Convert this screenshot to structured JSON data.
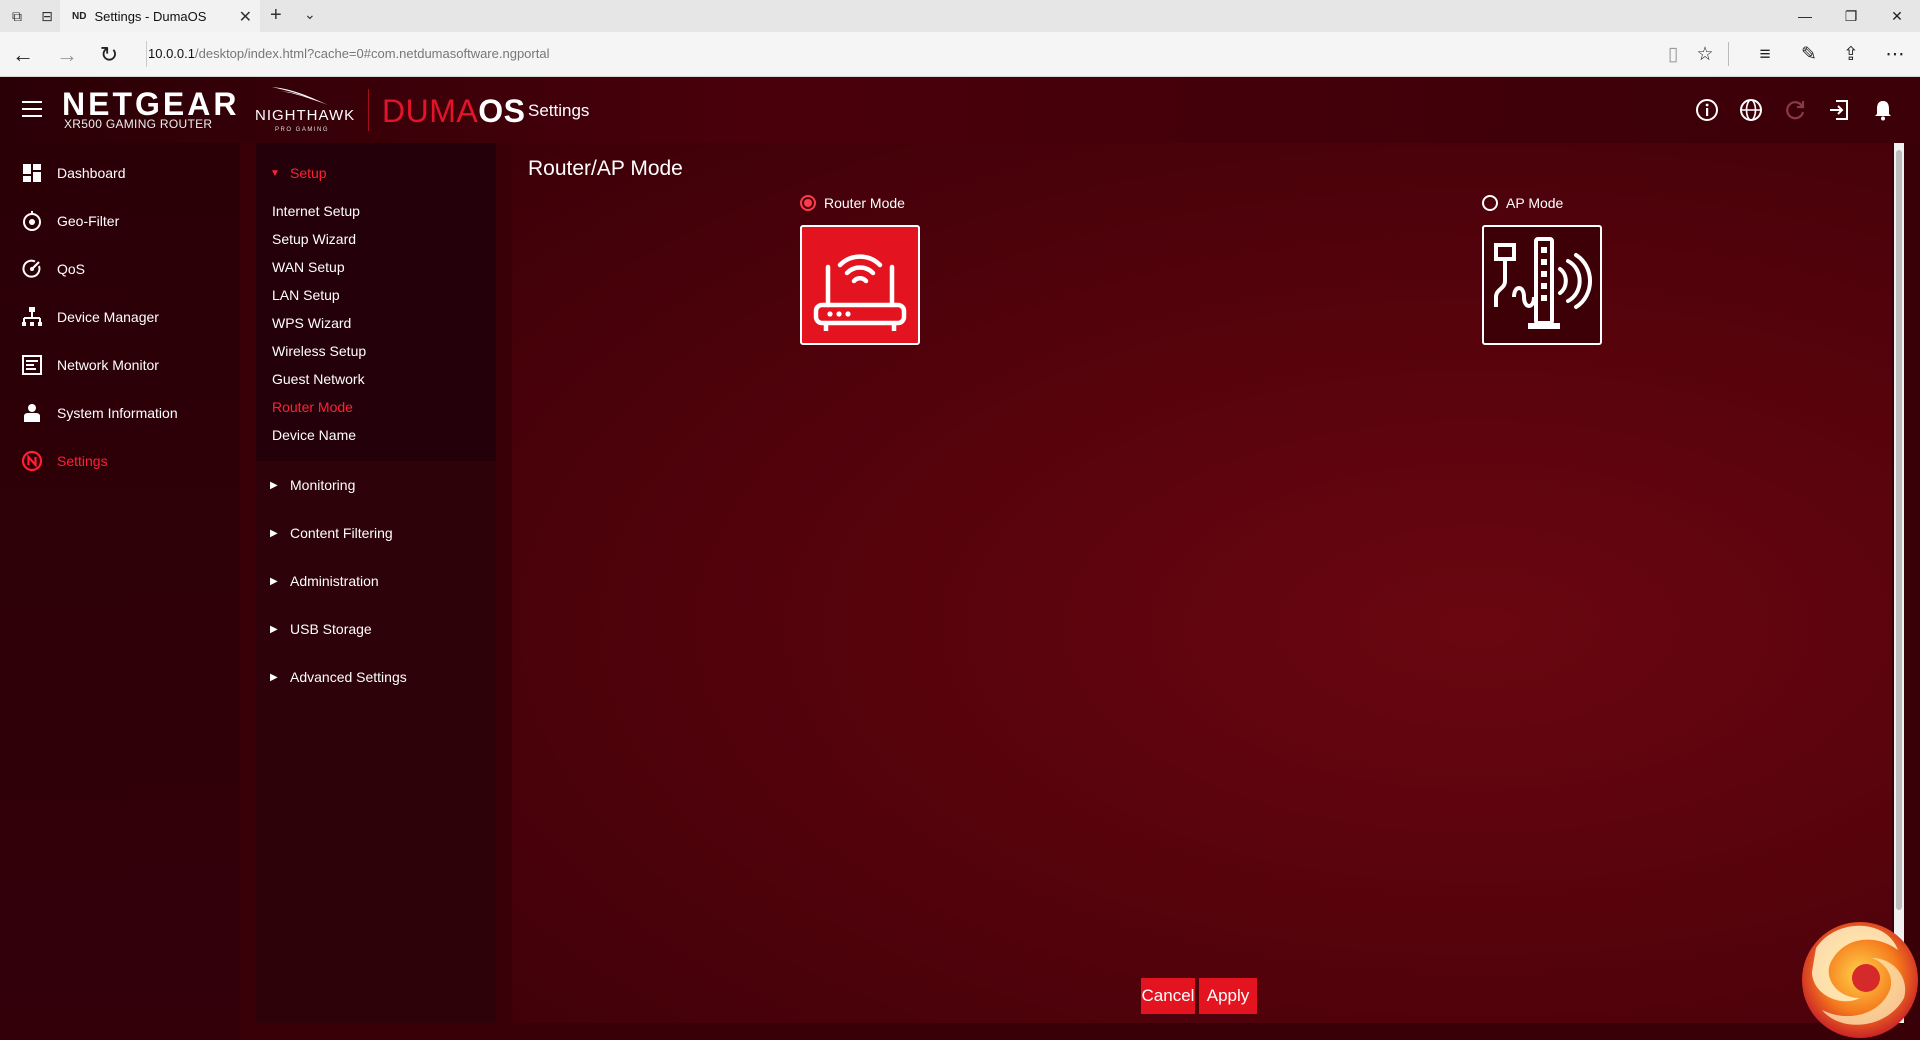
{
  "browser": {
    "tab_title": "Settings - DumaOS",
    "tab_favicon": "ND",
    "url_host": "10.0.0.1",
    "url_path": "/desktop/index.html?cache=0#com.netdumasoftware.ngportal"
  },
  "header": {
    "brand": "NETGEAR",
    "brand_sub": "XR500 GAMING ROUTER",
    "nighthawk": "NIGHTHAWK",
    "nighthawk_sub": "PRO GAMING",
    "duma_light": "DUMA",
    "duma_bold": "OS",
    "title": "Settings"
  },
  "leftnav": {
    "items": [
      {
        "label": "Dashboard",
        "icon": "dashboard-icon"
      },
      {
        "label": "Geo-Filter",
        "icon": "geo-filter-icon"
      },
      {
        "label": "QoS",
        "icon": "qos-icon"
      },
      {
        "label": "Device Manager",
        "icon": "device-manager-icon"
      },
      {
        "label": "Network Monitor",
        "icon": "network-monitor-icon"
      },
      {
        "label": "System Information",
        "icon": "system-information-icon"
      },
      {
        "label": "Settings",
        "icon": "settings-icon",
        "active": true
      }
    ]
  },
  "subnav": {
    "setup": {
      "label": "Setup",
      "links": [
        "Internet Setup",
        "Setup Wizard",
        "WAN Setup",
        "LAN Setup",
        "WPS Wizard",
        "Wireless Setup",
        "Guest Network",
        "Router Mode",
        "Device Name"
      ],
      "active": "Router Mode"
    },
    "sections": [
      "Monitoring",
      "Content Filtering",
      "Administration",
      "USB Storage",
      "Advanced Settings"
    ]
  },
  "main": {
    "title": "Router/AP Mode",
    "router_mode_label": "Router Mode",
    "ap_mode_label": "AP Mode",
    "selected": "Router Mode",
    "cancel_label": "Cancel",
    "apply_label": "Apply"
  },
  "colors": {
    "accent": "#e3141f",
    "active_text": "#ff2035",
    "background": "#3a0008"
  }
}
